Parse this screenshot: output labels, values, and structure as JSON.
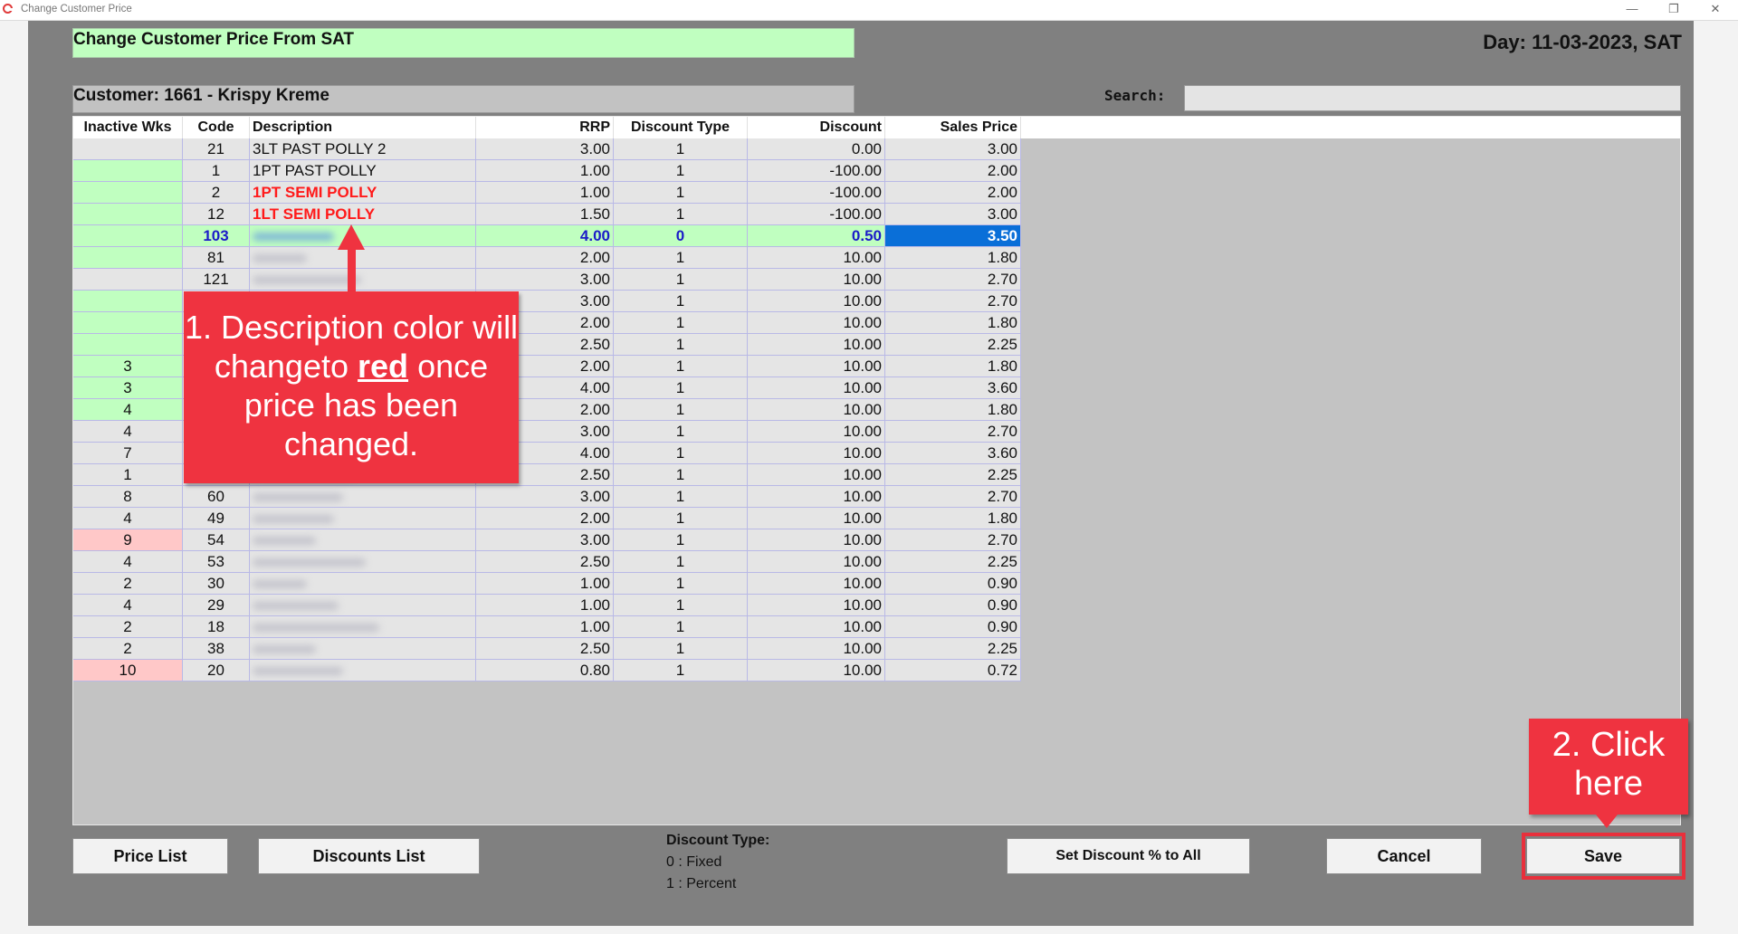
{
  "window": {
    "title": "Change Customer Price",
    "minimize": "—",
    "restore": "❐",
    "close": "✕"
  },
  "header": {
    "banner": "Change Customer Price From SAT",
    "day": "Day: 11-03-2023, SAT",
    "customer": "Customer: 1661 - Krispy Kreme",
    "search_label": "Search:",
    "search_value": ""
  },
  "table": {
    "columns": [
      "Inactive Wks",
      "Code",
      "Description",
      "RRP",
      "Discount Type",
      "Discount",
      "Sales Price"
    ],
    "rows": [
      {
        "inactive": "",
        "code": "21",
        "desc": "3LT PAST POLLY 2",
        "rrp": "3.00",
        "dtype": "1",
        "disc": "0.00",
        "sales": "3.00",
        "state": "normal",
        "inactive_color": ""
      },
      {
        "inactive": "",
        "code": "1",
        "desc": "1PT PAST POLLY",
        "rrp": "1.00",
        "dtype": "1",
        "disc": "-100.00",
        "sales": "2.00",
        "state": "normal",
        "inactive_color": "green"
      },
      {
        "inactive": "",
        "code": "2",
        "desc": "1PT SEMI POLLY",
        "rrp": "1.00",
        "dtype": "1",
        "disc": "-100.00",
        "sales": "2.00",
        "state": "changed",
        "inactive_color": "green"
      },
      {
        "inactive": "",
        "code": "12",
        "desc": "1LT SEMI POLLY",
        "rrp": "1.50",
        "dtype": "1",
        "disc": "-100.00",
        "sales": "3.00",
        "state": "changed",
        "inactive_color": "green"
      },
      {
        "inactive": "",
        "code": "103",
        "desc": "",
        "rrp": "4.00",
        "dtype": "0",
        "disc": "0.50",
        "sales": "3.50",
        "state": "selected",
        "inactive_color": "green"
      },
      {
        "inactive": "",
        "code": "81",
        "desc": "",
        "rrp": "2.00",
        "dtype": "1",
        "disc": "10.00",
        "sales": "1.80",
        "state": "normal",
        "inactive_color": "green"
      },
      {
        "inactive": "",
        "code": "121",
        "desc": "",
        "rrp": "3.00",
        "dtype": "1",
        "disc": "10.00",
        "sales": "2.70",
        "state": "normal",
        "inactive_color": ""
      },
      {
        "inactive": "",
        "code": "",
        "desc": "",
        "rrp": "3.00",
        "dtype": "1",
        "disc": "10.00",
        "sales": "2.70",
        "state": "normal",
        "inactive_color": "green"
      },
      {
        "inactive": "",
        "code": "",
        "desc": "",
        "rrp": "2.00",
        "dtype": "1",
        "disc": "10.00",
        "sales": "1.80",
        "state": "normal",
        "inactive_color": "green"
      },
      {
        "inactive": "",
        "code": "",
        "desc": "",
        "rrp": "2.50",
        "dtype": "1",
        "disc": "10.00",
        "sales": "2.25",
        "state": "normal",
        "inactive_color": "green"
      },
      {
        "inactive": "3",
        "code": "",
        "desc": "",
        "rrp": "2.00",
        "dtype": "1",
        "disc": "10.00",
        "sales": "1.80",
        "state": "normal",
        "inactive_color": "green"
      },
      {
        "inactive": "3",
        "code": "",
        "desc": "",
        "rrp": "4.00",
        "dtype": "1",
        "disc": "10.00",
        "sales": "3.60",
        "state": "normal",
        "inactive_color": "green"
      },
      {
        "inactive": "4",
        "code": "",
        "desc": "",
        "rrp": "2.00",
        "dtype": "1",
        "disc": "10.00",
        "sales": "1.80",
        "state": "normal",
        "inactive_color": "green"
      },
      {
        "inactive": "4",
        "code": "",
        "desc": "",
        "rrp": "3.00",
        "dtype": "1",
        "disc": "10.00",
        "sales": "2.70",
        "state": "normal",
        "inactive_color": ""
      },
      {
        "inactive": "7",
        "code": "",
        "desc": "",
        "rrp": "4.00",
        "dtype": "1",
        "disc": "10.00",
        "sales": "3.60",
        "state": "normal",
        "inactive_color": ""
      },
      {
        "inactive": "1",
        "code": "",
        "desc": "",
        "rrp": "2.50",
        "dtype": "1",
        "disc": "10.00",
        "sales": "2.25",
        "state": "normal",
        "inactive_color": ""
      },
      {
        "inactive": "8",
        "code": "60",
        "desc": "",
        "rrp": "3.00",
        "dtype": "1",
        "disc": "10.00",
        "sales": "2.70",
        "state": "normal",
        "inactive_color": ""
      },
      {
        "inactive": "4",
        "code": "49",
        "desc": "",
        "rrp": "2.00",
        "dtype": "1",
        "disc": "10.00",
        "sales": "1.80",
        "state": "normal",
        "inactive_color": ""
      },
      {
        "inactive": "9",
        "code": "54",
        "desc": "",
        "rrp": "3.00",
        "dtype": "1",
        "disc": "10.00",
        "sales": "2.70",
        "state": "normal",
        "inactive_color": "pink"
      },
      {
        "inactive": "4",
        "code": "53",
        "desc": "",
        "rrp": "2.50",
        "dtype": "1",
        "disc": "10.00",
        "sales": "2.25",
        "state": "normal",
        "inactive_color": ""
      },
      {
        "inactive": "2",
        "code": "30",
        "desc": "",
        "rrp": "1.00",
        "dtype": "1",
        "disc": "10.00",
        "sales": "0.90",
        "state": "normal",
        "inactive_color": ""
      },
      {
        "inactive": "4",
        "code": "29",
        "desc": "",
        "rrp": "1.00",
        "dtype": "1",
        "disc": "10.00",
        "sales": "0.90",
        "state": "normal",
        "inactive_color": ""
      },
      {
        "inactive": "2",
        "code": "18",
        "desc": "",
        "rrp": "1.00",
        "dtype": "1",
        "disc": "10.00",
        "sales": "0.90",
        "state": "normal",
        "inactive_color": ""
      },
      {
        "inactive": "2",
        "code": "38",
        "desc": "",
        "rrp": "2.50",
        "dtype": "1",
        "disc": "10.00",
        "sales": "2.25",
        "state": "normal",
        "inactive_color": ""
      },
      {
        "inactive": "10",
        "code": "20",
        "desc": "",
        "rrp": "0.80",
        "dtype": "1",
        "disc": "10.00",
        "sales": "0.72",
        "state": "normal",
        "inactive_color": "pink"
      }
    ]
  },
  "buttons": {
    "price_list": "Price List",
    "discounts_list": "Discounts List",
    "set_discount_all": "Set Discount % to All",
    "cancel": "Cancel",
    "save": "Save"
  },
  "legend": {
    "title": "Discount Type:",
    "fixed": "0 : Fixed",
    "percent": "1 : Percent"
  },
  "annotations": {
    "callout1_a": "1. Description color will changeto",
    "callout1_emph": "red",
    "callout1_b": "once price has been changed.",
    "callout2": "2. Click here"
  },
  "colors": {
    "changed_text": "#ff1a1a",
    "selected_row": "#c0ffc0",
    "selected_text": "#1c1cc8",
    "selected_cell": "#0a6fd8",
    "annotation": "#ef3340"
  }
}
